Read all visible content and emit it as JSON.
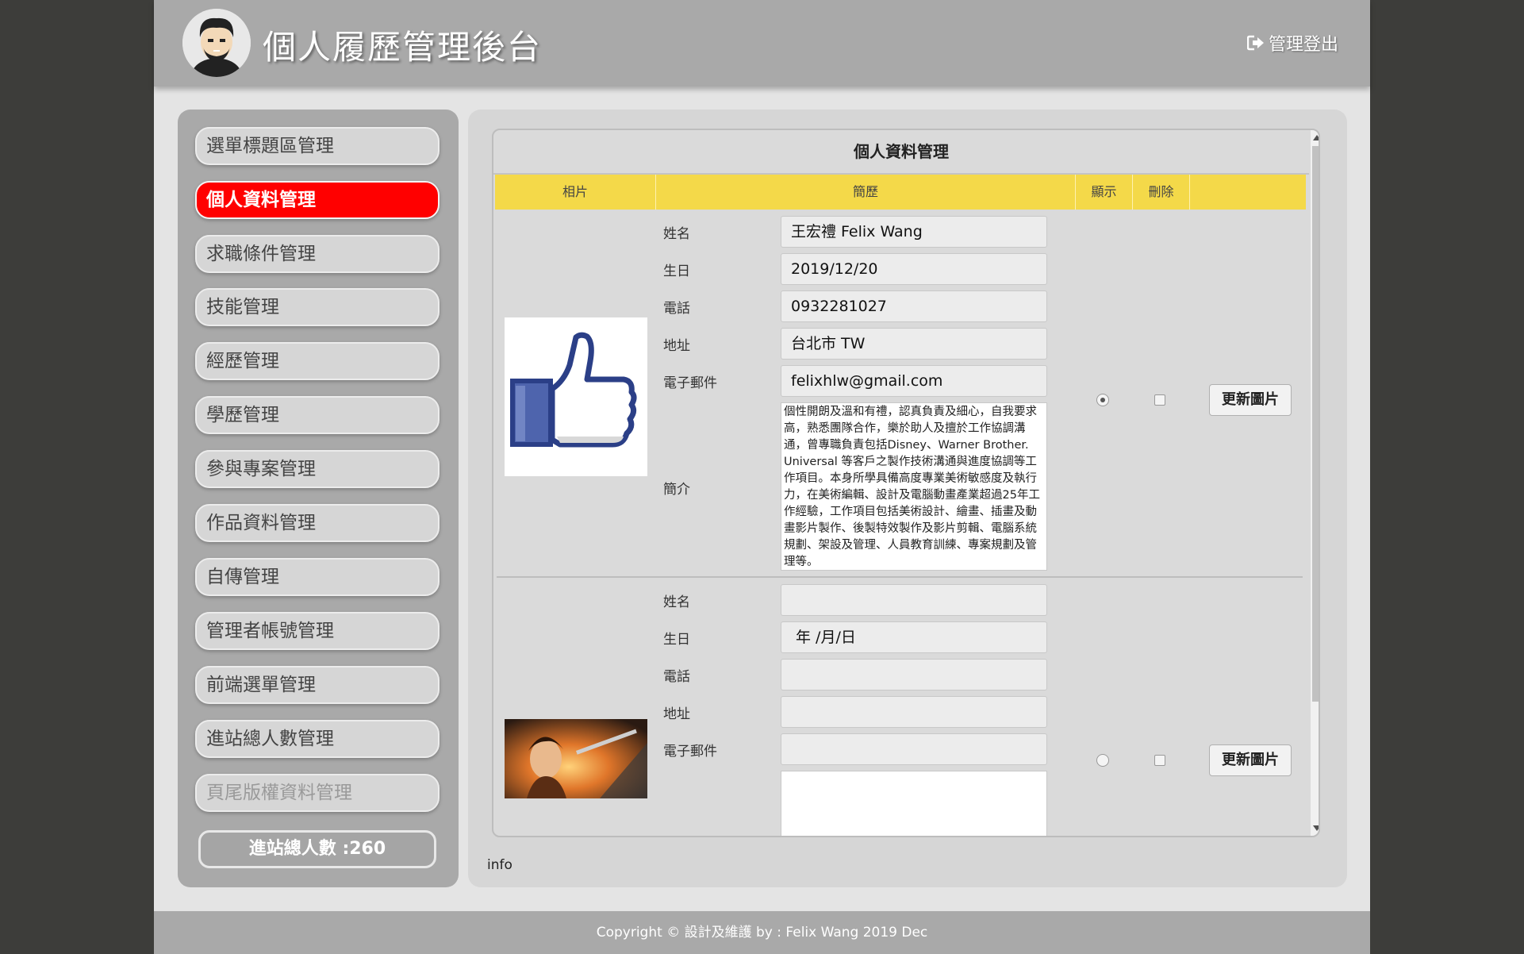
{
  "header": {
    "site_title": "個人履歷管理後台",
    "logout_label": "管理登出"
  },
  "sidebar": {
    "items": [
      {
        "label": "選單標題區管理"
      },
      {
        "label": "個人資料管理",
        "active": true
      },
      {
        "label": "求職條件管理"
      },
      {
        "label": "技能管理"
      },
      {
        "label": "經歷管理"
      },
      {
        "label": "學歷管理"
      },
      {
        "label": "參與專案管理"
      },
      {
        "label": "作品資料管理"
      },
      {
        "label": "自傳管理"
      },
      {
        "label": "管理者帳號管理"
      },
      {
        "label": "前端選單管理"
      },
      {
        "label": "進站總人數管理"
      },
      {
        "label": "頁尾版權資料管理"
      }
    ],
    "visit_count_label": "進站總人數 :260"
  },
  "panel": {
    "title": "個人資料管理",
    "columns": [
      "相片",
      "簡歷",
      "顯示",
      "刪除",
      ""
    ],
    "field_labels": {
      "name": "姓名",
      "birthday": "生日",
      "phone": "電話",
      "address": "地址",
      "email": "電子郵件",
      "intro": "簡介"
    },
    "colon": "：",
    "update_button_label": "更新圖片",
    "records": [
      {
        "name": "王宏禮 Felix Wang",
        "birthday": "2019/12/20",
        "phone": "0932281027",
        "address": "台北市 TW",
        "email": "felixhlw@gmail.com",
        "intro": "個性開朗及溫和有禮，認真負責及細心，自我要求高，熟悉團隊合作，樂於助人及擅於工作協調溝通，曾專職負責包括Disney、Warner Brother. Universal 等客戶之製作技術溝通與進度協調等工作項目。本身所學具備高度專業美術敏感度及執行力，在美術編輯、設計及電腦動畫產業超過25年工作經驗，工作項目包括美術設計、繪畫、插畫及動畫影片製作、後製特效製作及影片剪輯、電腦系統規劃、架設及管理、人員教育訓練、專案規劃及管理等。",
        "display": true,
        "delete": false
      },
      {
        "name": "",
        "birthday": "年 /月/日",
        "phone": "",
        "address": "",
        "email": "",
        "intro": "",
        "display": false,
        "delete": false
      }
    ]
  },
  "info_text": "info",
  "footer": {
    "copyright": "Copyright © 設計及維護 by : Felix Wang 2019 Dec"
  },
  "colors": {
    "header_bg": "#a9a9a9",
    "active_menu": "#ff0000",
    "table_header": "#f4d949",
    "outer_bg": "#3d3d3a"
  }
}
